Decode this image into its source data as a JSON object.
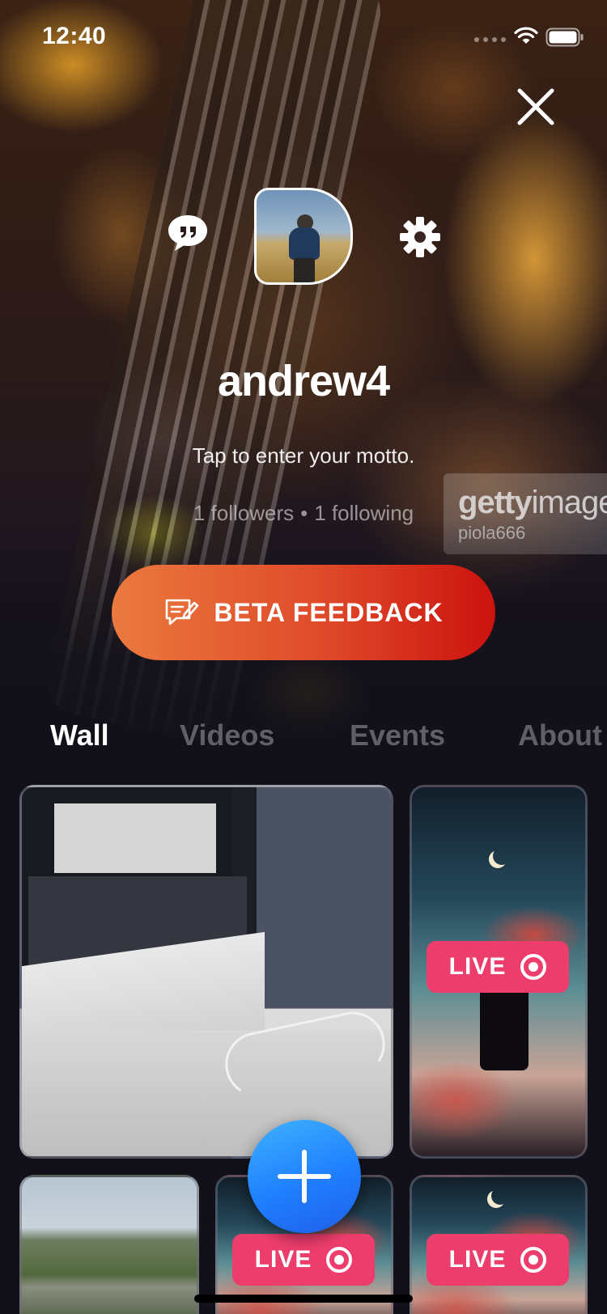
{
  "status_bar": {
    "time": "12:40",
    "icons": [
      "signal-dots-icon",
      "wifi-icon",
      "battery-icon"
    ]
  },
  "header": {
    "close_icon": "close-icon",
    "chat_icon": "chat-quote-icon",
    "settings_icon": "gear-icon"
  },
  "background_watermark": {
    "brand_bold": "getty",
    "brand_light": "images",
    "user": "piola666"
  },
  "profile": {
    "username": "andrew4",
    "motto_placeholder": "Tap to enter your motto.",
    "followers": "1 followers",
    "separator": "•",
    "following": "1 following"
  },
  "feedback_button": {
    "label": "BETA FEEDBACK",
    "icon": "feedback-edit-icon"
  },
  "tabs": [
    {
      "label": "Wall",
      "active": true
    },
    {
      "label": "Videos",
      "active": false
    },
    {
      "label": "Events",
      "active": false
    },
    {
      "label": "About",
      "active": false
    }
  ],
  "grid": {
    "tiles": [
      {
        "kind": "photo",
        "subject": "desktop computer"
      },
      {
        "kind": "live",
        "badge": "LIVE"
      },
      {
        "kind": "photo",
        "subject": "city highway"
      },
      {
        "kind": "live",
        "badge": "LIVE"
      },
      {
        "kind": "live",
        "badge": "LIVE"
      }
    ]
  },
  "fab": {
    "icon": "plus-icon"
  },
  "colors": {
    "background": "#12111a",
    "feedback_start": "#eb7a3e",
    "feedback_end": "#cc120e",
    "live_badge": "#ec3d6c",
    "fab": "#1f7fff",
    "tab_active": "#ffffff"
  }
}
